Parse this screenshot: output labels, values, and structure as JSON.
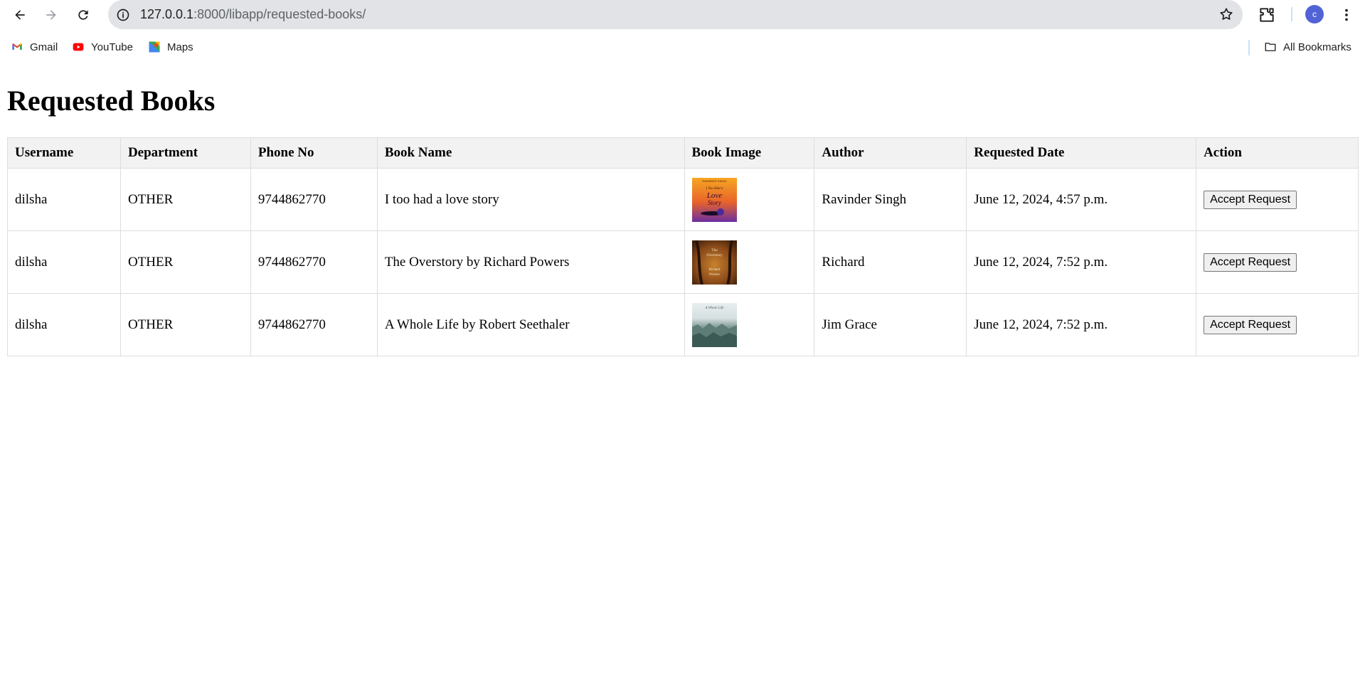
{
  "browser": {
    "url_host": "127.0.0.1",
    "url_rest": ":8000/libapp/requested-books/",
    "profile_initial": "c",
    "bookmarks": [
      "Gmail",
      "YouTube",
      "Maps"
    ],
    "all_bookmarks": "All Bookmarks"
  },
  "page": {
    "title": "Requested Books",
    "columns": [
      "Username",
      "Department",
      "Phone No",
      "Book Name",
      "Book Image",
      "Author",
      "Requested Date",
      "Action"
    ],
    "rows": [
      {
        "username": "dilsha",
        "department": "OTHER",
        "phone": "9744862770",
        "book_name": "I too had a love story",
        "cover_lines": [
          "RAVINDER SINGH",
          "I Too Had a",
          "Love",
          "Story"
        ],
        "author": "Ravinder Singh",
        "requested_date": "June 12, 2024, 4:57 p.m.",
        "action": "Accept Request"
      },
      {
        "username": "dilsha",
        "department": "OTHER",
        "phone": "9744862770",
        "book_name": "The Overstory by Richard Powers",
        "cover_lines": [
          "The",
          "Overstory",
          "Richard",
          "Powers"
        ],
        "author": "Richard",
        "requested_date": "June 12, 2024, 7:52 p.m.",
        "action": "Accept Request"
      },
      {
        "username": "dilsha",
        "department": "OTHER",
        "phone": "9744862770",
        "book_name": "A Whole Life by Robert Seethaler",
        "cover_lines": [
          "A Whole Life"
        ],
        "author": "Jim Grace",
        "requested_date": "June 12, 2024, 7:52 p.m.",
        "action": "Accept Request"
      }
    ]
  }
}
